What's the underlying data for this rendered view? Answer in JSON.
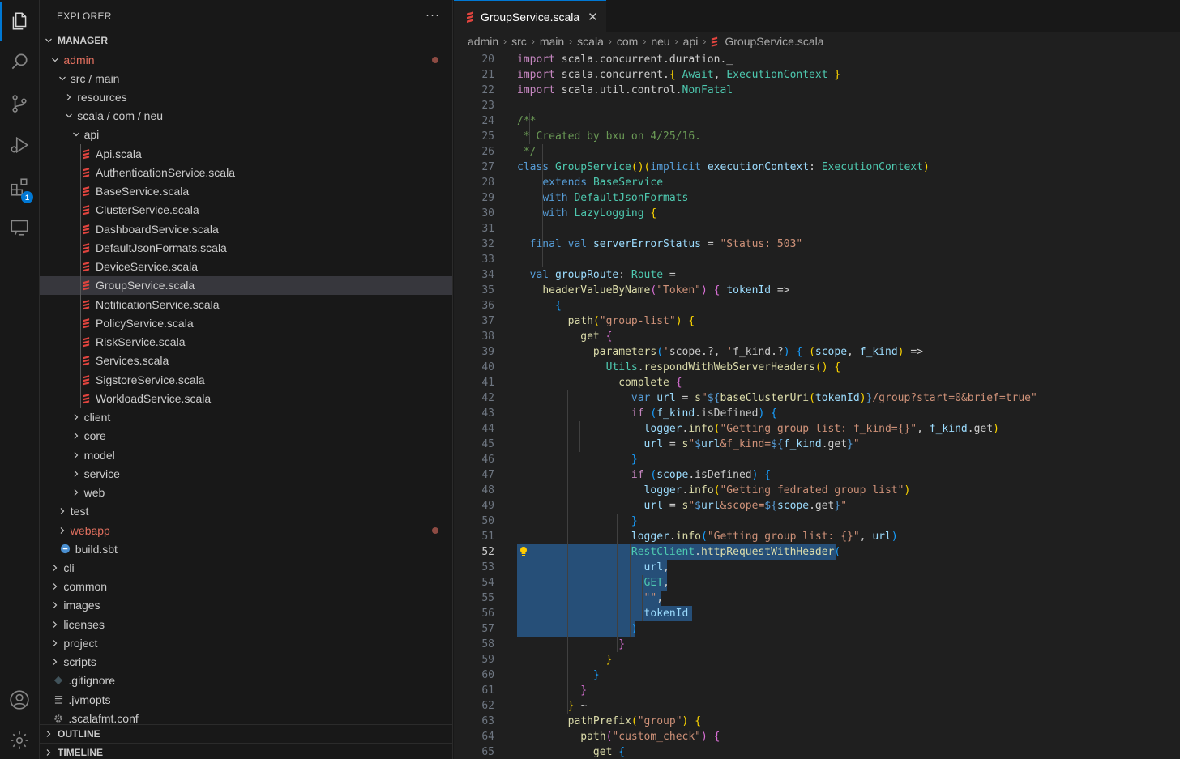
{
  "sidebar": {
    "title": "EXPLORER",
    "more": "···",
    "root_label": "MANAGER",
    "outline_label": "OUTLINE",
    "timeline_label": "TIMELINE",
    "tree": [
      {
        "label": "admin",
        "depth": 1,
        "kind": "folder",
        "open": true,
        "modified": true
      },
      {
        "label": "src / main",
        "depth": 2,
        "kind": "folder",
        "open": true
      },
      {
        "label": "resources",
        "depth": 3,
        "kind": "folder",
        "open": false
      },
      {
        "label": "scala / com / neu",
        "depth": 3,
        "kind": "folder",
        "open": true
      },
      {
        "label": "api",
        "depth": 4,
        "kind": "folder",
        "open": true
      },
      {
        "label": "Api.scala",
        "depth": 5,
        "kind": "scala"
      },
      {
        "label": "AuthenticationService.scala",
        "depth": 5,
        "kind": "scala"
      },
      {
        "label": "BaseService.scala",
        "depth": 5,
        "kind": "scala"
      },
      {
        "label": "ClusterService.scala",
        "depth": 5,
        "kind": "scala"
      },
      {
        "label": "DashboardService.scala",
        "depth": 5,
        "kind": "scala"
      },
      {
        "label": "DefaultJsonFormats.scala",
        "depth": 5,
        "kind": "scala"
      },
      {
        "label": "DeviceService.scala",
        "depth": 5,
        "kind": "scala"
      },
      {
        "label": "GroupService.scala",
        "depth": 5,
        "kind": "scala",
        "selected": true
      },
      {
        "label": "NotificationService.scala",
        "depth": 5,
        "kind": "scala"
      },
      {
        "label": "PolicyService.scala",
        "depth": 5,
        "kind": "scala"
      },
      {
        "label": "RiskService.scala",
        "depth": 5,
        "kind": "scala"
      },
      {
        "label": "Services.scala",
        "depth": 5,
        "kind": "scala"
      },
      {
        "label": "SigstoreService.scala",
        "depth": 5,
        "kind": "scala"
      },
      {
        "label": "WorkloadService.scala",
        "depth": 5,
        "kind": "scala"
      },
      {
        "label": "client",
        "depth": 4,
        "kind": "folder",
        "open": false
      },
      {
        "label": "core",
        "depth": 4,
        "kind": "folder",
        "open": false
      },
      {
        "label": "model",
        "depth": 4,
        "kind": "folder",
        "open": false
      },
      {
        "label": "service",
        "depth": 4,
        "kind": "folder",
        "open": false
      },
      {
        "label": "web",
        "depth": 4,
        "kind": "folder",
        "open": false
      },
      {
        "label": "test",
        "depth": 2,
        "kind": "folder",
        "open": false
      },
      {
        "label": "webapp",
        "depth": 2,
        "kind": "folder",
        "open": false,
        "modified": true
      },
      {
        "label": "build.sbt",
        "depth": 2,
        "kind": "sbt"
      },
      {
        "label": "cli",
        "depth": 1,
        "kind": "folder",
        "open": false
      },
      {
        "label": "common",
        "depth": 1,
        "kind": "folder",
        "open": false
      },
      {
        "label": "images",
        "depth": 1,
        "kind": "folder",
        "open": false
      },
      {
        "label": "licenses",
        "depth": 1,
        "kind": "folder",
        "open": false
      },
      {
        "label": "project",
        "depth": 1,
        "kind": "folder",
        "open": false
      },
      {
        "label": "scripts",
        "depth": 1,
        "kind": "folder",
        "open": false
      },
      {
        "label": ".gitignore",
        "depth": 1,
        "kind": "git"
      },
      {
        "label": ".jvmopts",
        "depth": 1,
        "kind": "text"
      },
      {
        "label": ".scalafmt.conf",
        "depth": 1,
        "kind": "gear"
      }
    ]
  },
  "activity": {
    "items": [
      "explorer-icon",
      "search-icon",
      "source-control-icon",
      "run-debug-icon",
      "extensions-icon",
      "remote-explorer-icon"
    ],
    "extensions_badge": "1",
    "bottom": [
      "account-icon",
      "manage-gear-icon"
    ]
  },
  "editor": {
    "tab_label": "GroupService.scala",
    "breadcrumb": [
      "admin",
      "src",
      "main",
      "scala",
      "com",
      "neu",
      "api",
      "GroupService.scala"
    ],
    "current_line": 52,
    "lines": [
      {
        "n": 20,
        "html": "<span class='kp'>import</span> scala.concurrent.duration._"
      },
      {
        "n": 21,
        "html": "<span class='kp'>import</span> scala.concurrent.<span class='p1'>{</span> <span class='t'>Await</span>, <span class='t'>ExecutionContext</span> <span class='p1'>}</span>"
      },
      {
        "n": 22,
        "html": "<span class='kp'>import</span> scala.util.control.<span class='t'>NonFatal</span>"
      },
      {
        "n": 23,
        "html": ""
      },
      {
        "n": 24,
        "html": "<span class='c'>/**</span>"
      },
      {
        "n": 25,
        "html": "<span class='c'> * Created by bxu on 4/25/16.</span>"
      },
      {
        "n": 26,
        "html": "<span class='c'> */</span>"
      },
      {
        "n": 27,
        "html": "<span class='k'>class</span> <span class='t'>GroupService</span><span class='p1'>()(</span><span class='k'>implicit</span> <span class='v'>executionContext</span>: <span class='t'>ExecutionContext</span><span class='p1'>)</span>"
      },
      {
        "n": 28,
        "html": "    <span class='k'>extends</span> <span class='t'>BaseService</span>"
      },
      {
        "n": 29,
        "html": "    <span class='k'>with</span> <span class='t'>DefaultJsonFormats</span>"
      },
      {
        "n": 30,
        "html": "    <span class='k'>with</span> <span class='t'>LazyLogging</span> <span class='p1'>{</span>"
      },
      {
        "n": 31,
        "html": ""
      },
      {
        "n": 32,
        "html": "  <span class='k'>final</span> <span class='k'>val</span> <span class='v'>serverErrorStatus</span> = <span class='s'>\"Status: 503\"</span>"
      },
      {
        "n": 33,
        "html": ""
      },
      {
        "n": 34,
        "html": "  <span class='k'>val</span> <span class='v'>groupRoute</span>: <span class='t'>Route</span> ="
      },
      {
        "n": 35,
        "html": "    <span class='f'>headerValueByName</span><span class='p2'>(</span><span class='s'>\"Token\"</span><span class='p2'>)</span> <span class='p2'>{</span> <span class='v'>tokenId</span> =>"
      },
      {
        "n": 36,
        "html": "      <span class='p3'>{</span>"
      },
      {
        "n": 37,
        "html": "        <span class='f'>path</span><span class='p1'>(</span><span class='s'>\"group-list\"</span><span class='p1'>)</span> <span class='p1'>{</span>"
      },
      {
        "n": 38,
        "html": "          <span class='f'>get</span> <span class='p2'>{</span>"
      },
      {
        "n": 39,
        "html": "            <span class='f'>parameters</span><span class='p3'>(</span><span class='s'>'</span>scope.?, <span class='s'>'</span>f_kind.?<span class='p3'>)</span> <span class='p3'>{</span> <span class='p1'>(</span><span class='v'>scope</span>, <span class='v'>f_kind</span><span class='p1'>)</span> =>"
      },
      {
        "n": 40,
        "html": "              <span class='t'>Utils</span>.<span class='f'>respondWithWebServerHeaders</span><span class='p1'>()</span> <span class='p1'>{</span>"
      },
      {
        "n": 41,
        "html": "                <span class='f'>complete</span> <span class='p2'>{</span>"
      },
      {
        "n": 42,
        "html": "                  <span class='k'>var</span> <span class='v'>url</span> = <span class='f'>s</span><span class='s'>\"</span><span class='k'>${</span><span class='f'>baseClusterUri</span><span class='p1'>(</span><span class='v'>tokenId</span><span class='p1'>)</span><span class='k'>}</span><span class='s'>/group?start=0&amp;brief=true\"</span>"
      },
      {
        "n": 43,
        "html": "                  <span class='kp'>if</span> <span class='p3'>(</span><span class='v'>f_kind</span>.isDefined<span class='p3'>)</span> <span class='p3'>{</span>"
      },
      {
        "n": 44,
        "html": "                    <span class='v'>logger</span>.<span class='f'>info</span><span class='p1'>(</span><span class='s'>\"Getting group list: f_kind={}\"</span>, <span class='v'>f_kind</span>.get<span class='p1'>)</span>"
      },
      {
        "n": 45,
        "html": "                    <span class='v'>url</span> = <span class='f'>s</span><span class='s'>\"</span><span class='k'>$</span><span class='v'>url</span><span class='s'>&amp;f_kind=</span><span class='k'>${</span><span class='v'>f_kind</span>.get<span class='k'>}</span><span class='s'>\"</span>"
      },
      {
        "n": 46,
        "html": "                  <span class='p3'>}</span>"
      },
      {
        "n": 47,
        "html": "                  <span class='kp'>if</span> <span class='p3'>(</span><span class='v'>scope</span>.isDefined<span class='p3'>)</span> <span class='p3'>{</span>"
      },
      {
        "n": 48,
        "html": "                    <span class='v'>logger</span>.<span class='f'>info</span><span class='p1'>(</span><span class='s'>\"Getting fedrated group list\"</span><span class='p1'>)</span>"
      },
      {
        "n": 49,
        "html": "                    <span class='v'>url</span> = <span class='f'>s</span><span class='s'>\"</span><span class='k'>$</span><span class='v'>url</span><span class='s'>&amp;scope=</span><span class='k'>${</span><span class='v'>scope</span>.get<span class='k'>}</span><span class='s'>\"</span>"
      },
      {
        "n": 50,
        "html": "                  <span class='p3'>}</span>"
      },
      {
        "n": 51,
        "html": "                  <span class='v'>logger</span>.<span class='f'>info</span><span class='p3'>(</span><span class='s'>\"Getting group list: {}\"</span>, <span class='v'>url</span><span class='p3'>)</span>"
      },
      {
        "n": 52,
        "html": "                  <span class='t'>RestClient</span>.<span class='f'>httpRequestWithHeader</span><span class='p3'>(</span>"
      },
      {
        "n": 53,
        "html": "                    <span class='v'>url</span>,"
      },
      {
        "n": 54,
        "html": "                    <span class='t'>GET</span>,"
      },
      {
        "n": 55,
        "html": "                    <span class='s'>\"\"</span>,"
      },
      {
        "n": 56,
        "html": "                    <span class='v'>tokenId</span>"
      },
      {
        "n": 57,
        "html": "                  <span class='p3'>)</span>"
      },
      {
        "n": 58,
        "html": "                <span class='p2'>}</span>"
      },
      {
        "n": 59,
        "html": "              <span class='p1'>}</span>"
      },
      {
        "n": 60,
        "html": "            <span class='p3'>}</span>"
      },
      {
        "n": 61,
        "html": "          <span class='p2'>}</span>"
      },
      {
        "n": 62,
        "html": "        <span class='p1'>}</span> ~"
      },
      {
        "n": 63,
        "html": "        <span class='f'>pathPrefix</span><span class='p1'>(</span><span class='s'>\"group\"</span><span class='p1'>)</span> <span class='p1'>{</span>"
      },
      {
        "n": 64,
        "html": "          <span class='f'>path</span><span class='p2'>(</span><span class='s'>\"custom_check\"</span><span class='p2'>)</span> <span class='p2'>{</span>"
      },
      {
        "n": 65,
        "html": "            <span class='f'>get</span> <span class='p3'>{</span>"
      }
    ]
  }
}
